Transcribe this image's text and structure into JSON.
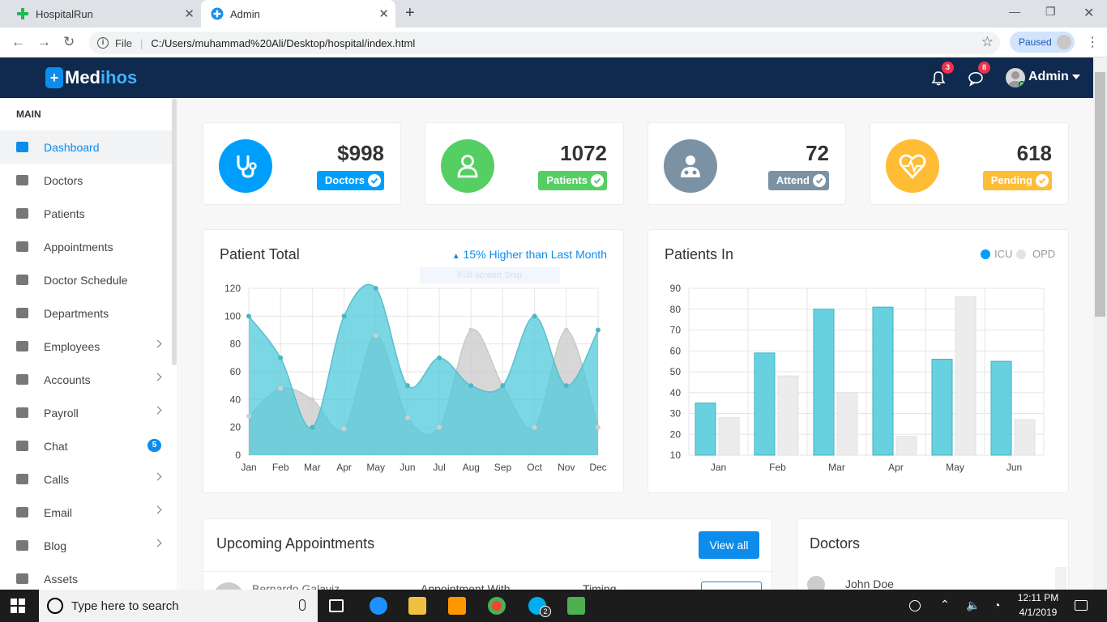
{
  "browser": {
    "tabs": [
      {
        "title": "HospitalRun"
      },
      {
        "title": "Admin"
      }
    ],
    "address": {
      "scheme_label": "File",
      "url": "C:/Users/muhammad%20Ali/Desktop/hospital/index.html"
    },
    "profile_status": "Paused"
  },
  "header": {
    "logo_med": "Med",
    "logo_ihos": "ihos",
    "notifications_count": "3",
    "messages_count": "8",
    "user_name": "Admin"
  },
  "sidebar": {
    "section_title": "MAIN",
    "items": [
      {
        "label": "Dashboard",
        "icon": "dashboard-icon"
      },
      {
        "label": "Doctors",
        "icon": "user-md-icon"
      },
      {
        "label": "Patients",
        "icon": "wheelchair-icon"
      },
      {
        "label": "Appointments",
        "icon": "calendar-icon"
      },
      {
        "label": "Doctor Schedule",
        "icon": "calendar-check-icon"
      },
      {
        "label": "Departments",
        "icon": "hospital-icon"
      },
      {
        "label": "Employees",
        "icon": "user-icon"
      },
      {
        "label": "Accounts",
        "icon": "money-icon"
      },
      {
        "label": "Payroll",
        "icon": "book-icon"
      },
      {
        "label": "Chat",
        "icon": "comments-icon",
        "badge": "5"
      },
      {
        "label": "Calls",
        "icon": "video-camera-icon"
      },
      {
        "label": "Email",
        "icon": "envelope-icon"
      },
      {
        "label": "Blog",
        "icon": "commenting-icon"
      },
      {
        "label": "Assets",
        "icon": "cube-icon"
      }
    ]
  },
  "stats": [
    {
      "value": "$998",
      "label": "Doctors",
      "color": "#009efb",
      "icon": "stethoscope-icon"
    },
    {
      "value": "1072",
      "label": "Patients",
      "color": "#55ce63",
      "icon": "user-o-icon"
    },
    {
      "value": "72",
      "label": "Attend",
      "color": "#7a92a3",
      "icon": "user-md-icon"
    },
    {
      "value": "618",
      "label": "Pending",
      "color": "#ffbc35",
      "icon": "heartbeat-icon"
    }
  ],
  "patient_total": {
    "title": "Patient Total",
    "trend": "15% Higher than Last Month"
  },
  "patients_in": {
    "title": "Patients In",
    "legend": [
      {
        "name": "ICU",
        "color": "#009efb"
      },
      {
        "name": "OPD",
        "color": "#e3e3e3"
      }
    ]
  },
  "chart_data": [
    {
      "type": "area",
      "title": "Patient Total",
      "categories": [
        "Jan",
        "Feb",
        "Mar",
        "Apr",
        "May",
        "Jun",
        "Jul",
        "Aug",
        "Sep",
        "Oct",
        "Nov",
        "Dec"
      ],
      "ylim": [
        0,
        120
      ],
      "yticks": [
        0,
        20,
        40,
        60,
        80,
        100,
        120
      ],
      "grid": true,
      "series": [
        {
          "values": [
            100,
            70,
            20,
            100,
            120,
            50,
            70,
            50,
            50,
            100,
            50,
            90
          ],
          "color": "#4dc9d9"
        },
        {
          "values": [
            28,
            48,
            40,
            19,
            86,
            27,
            20,
            90,
            50,
            20,
            90,
            20
          ],
          "color": "#d9d9d9"
        }
      ]
    },
    {
      "type": "bar",
      "title": "Patients In",
      "categories": [
        "Jan",
        "Feb",
        "Mar",
        "Apr",
        "May",
        "Jun"
      ],
      "ylim": [
        10,
        90
      ],
      "yticks": [
        10,
        20,
        30,
        40,
        50,
        60,
        70,
        80,
        90
      ],
      "grid": true,
      "series": [
        {
          "name": "ICU",
          "values": [
            35,
            59,
            80,
            81,
            56,
            55
          ],
          "color": "#68d1df"
        },
        {
          "name": "OPD",
          "values": [
            28,
            48,
            40,
            19,
            86,
            27
          ],
          "color": "#ececec"
        }
      ]
    }
  ],
  "snip_overlay": "Full-screen Snip",
  "appointments": {
    "title": "Upcoming Appointments",
    "view_all": "View all",
    "row": {
      "patient": "Bernardo Galaviz",
      "col2": "Appointment With",
      "col3": "Timing"
    }
  },
  "doctors_panel": {
    "title": "Doctors",
    "first": "John Doe"
  },
  "taskbar": {
    "search_placeholder": "Type here to search",
    "time": "12:11 PM",
    "date": "4/1/2019",
    "skype_badge": "2"
  }
}
